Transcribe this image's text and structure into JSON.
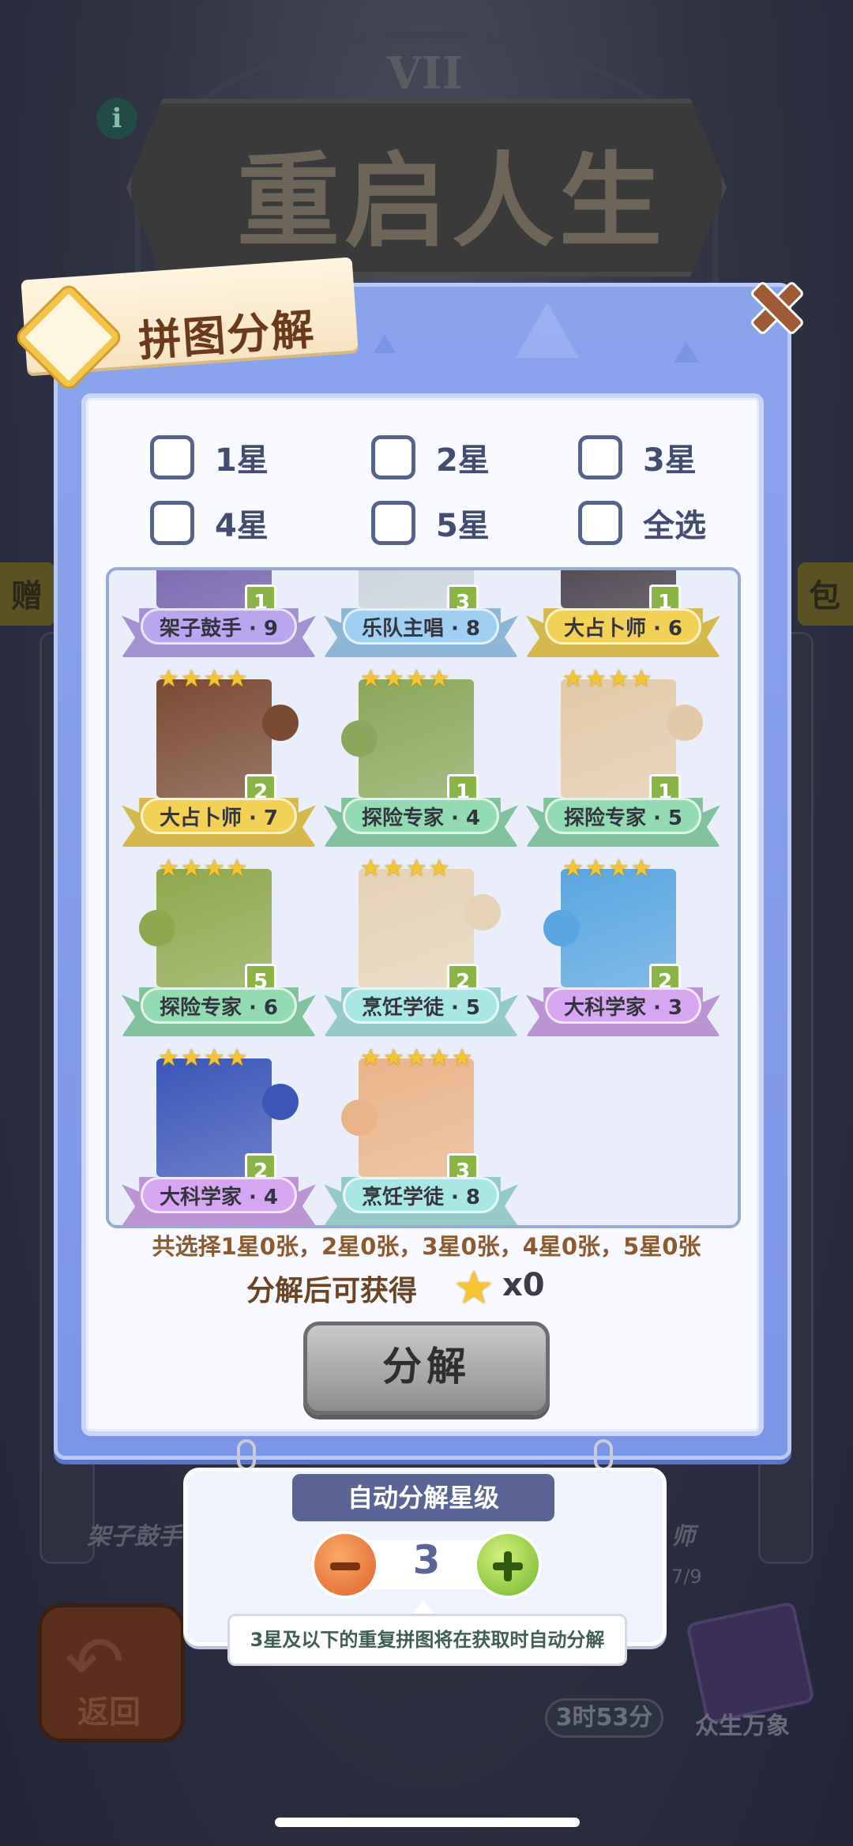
{
  "background": {
    "title": "重启人生",
    "clock_numeral": "VII",
    "banner_left": "赠",
    "banner_right": "包",
    "back_label": "返回",
    "timer": "3时53分",
    "book_label": "众生万象",
    "faded_left_label": "架子鼓手",
    "faded_right_label": "师",
    "faded_count": "7/9"
  },
  "dialog": {
    "title": "拼图分解",
    "filters": [
      {
        "label": "1星",
        "checked": false
      },
      {
        "label": "2星",
        "checked": false
      },
      {
        "label": "3星",
        "checked": false
      },
      {
        "label": "4星",
        "checked": false
      },
      {
        "label": "5星",
        "checked": false
      },
      {
        "label": "全选",
        "checked": false
      }
    ],
    "cards": [
      {
        "name": "架子鼓手 · 9",
        "stars": 0,
        "count": "1",
        "ribbon": "#b9a6ee",
        "art": "#6b5aa8"
      },
      {
        "name": "乐队主唱 · 8",
        "stars": 0,
        "count": "3",
        "ribbon": "#9fd0f3",
        "art": "#c7d0dc"
      },
      {
        "name": "大占卜师 · 6",
        "stars": 0,
        "count": "1",
        "ribbon": "#f3d157",
        "art": "#3b3540"
      },
      {
        "name": "大占卜师 · 7",
        "stars": 4,
        "count": "2",
        "ribbon": "#f3d157",
        "art": "#7a4b32"
      },
      {
        "name": "探险专家 · 4",
        "stars": 4,
        "count": "1",
        "ribbon": "#93dcb3",
        "art": "#8aa85b"
      },
      {
        "name": "探险专家 · 5",
        "stars": 4,
        "count": "1",
        "ribbon": "#93dcb3",
        "art": "#e3c9a7"
      },
      {
        "name": "探险专家 · 6",
        "stars": 4,
        "count": "5",
        "ribbon": "#93dcb3",
        "art": "#8fa84f"
      },
      {
        "name": "烹饪学徒 · 5",
        "stars": 4,
        "count": "2",
        "ribbon": "#a8e7e3",
        "art": "#e6d2b5"
      },
      {
        "name": "大科学家 · 3",
        "stars": 4,
        "count": "2",
        "ribbon": "#d6a7f0",
        "art": "#5aa6e0"
      },
      {
        "name": "大科学家 · 4",
        "stars": 4,
        "count": "2",
        "ribbon": "#d6a7f0",
        "art": "#3a57b8"
      },
      {
        "name": "烹饪学徒 · 8",
        "stars": 5,
        "count": "3",
        "ribbon": "#a8e7e3",
        "art": "#e9b48a"
      }
    ],
    "summary": "共选择1星0张，2星0张，3星0张，4星0张，5星0张",
    "reward_label": "分解后可获得",
    "reward_value": "x0",
    "decompose_button": "分解"
  },
  "auto_panel": {
    "header": "自动分解星级",
    "value": "3",
    "tooltip": "3星及以下的重复拼图将在获取时自动分解"
  },
  "colors": {
    "dialog_bg": "#8aa4ec",
    "title_brown": "#6b3a1a",
    "button_gray": "#a9a9a9",
    "minus_orange": "#e0622a",
    "plus_green": "#6eb72a"
  }
}
